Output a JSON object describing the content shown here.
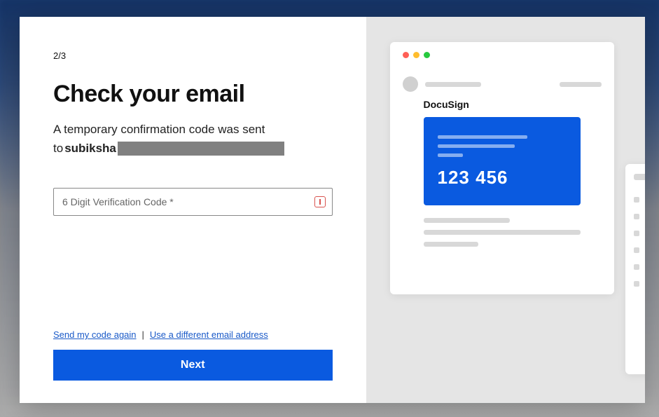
{
  "step": "2/3",
  "title": "Check your email",
  "subtitle": "A temporary confirmation code was sent",
  "to_prefix": "to ",
  "email_visible": "subiksha",
  "input": {
    "placeholder": "6 Digit Verification Code *",
    "value": ""
  },
  "links": {
    "resend": "Send my code again",
    "separator": "|",
    "different_email": "Use a different email address"
  },
  "next_label": "Next",
  "illustration": {
    "brand": "DocuSign",
    "sample_code": "123 456"
  }
}
